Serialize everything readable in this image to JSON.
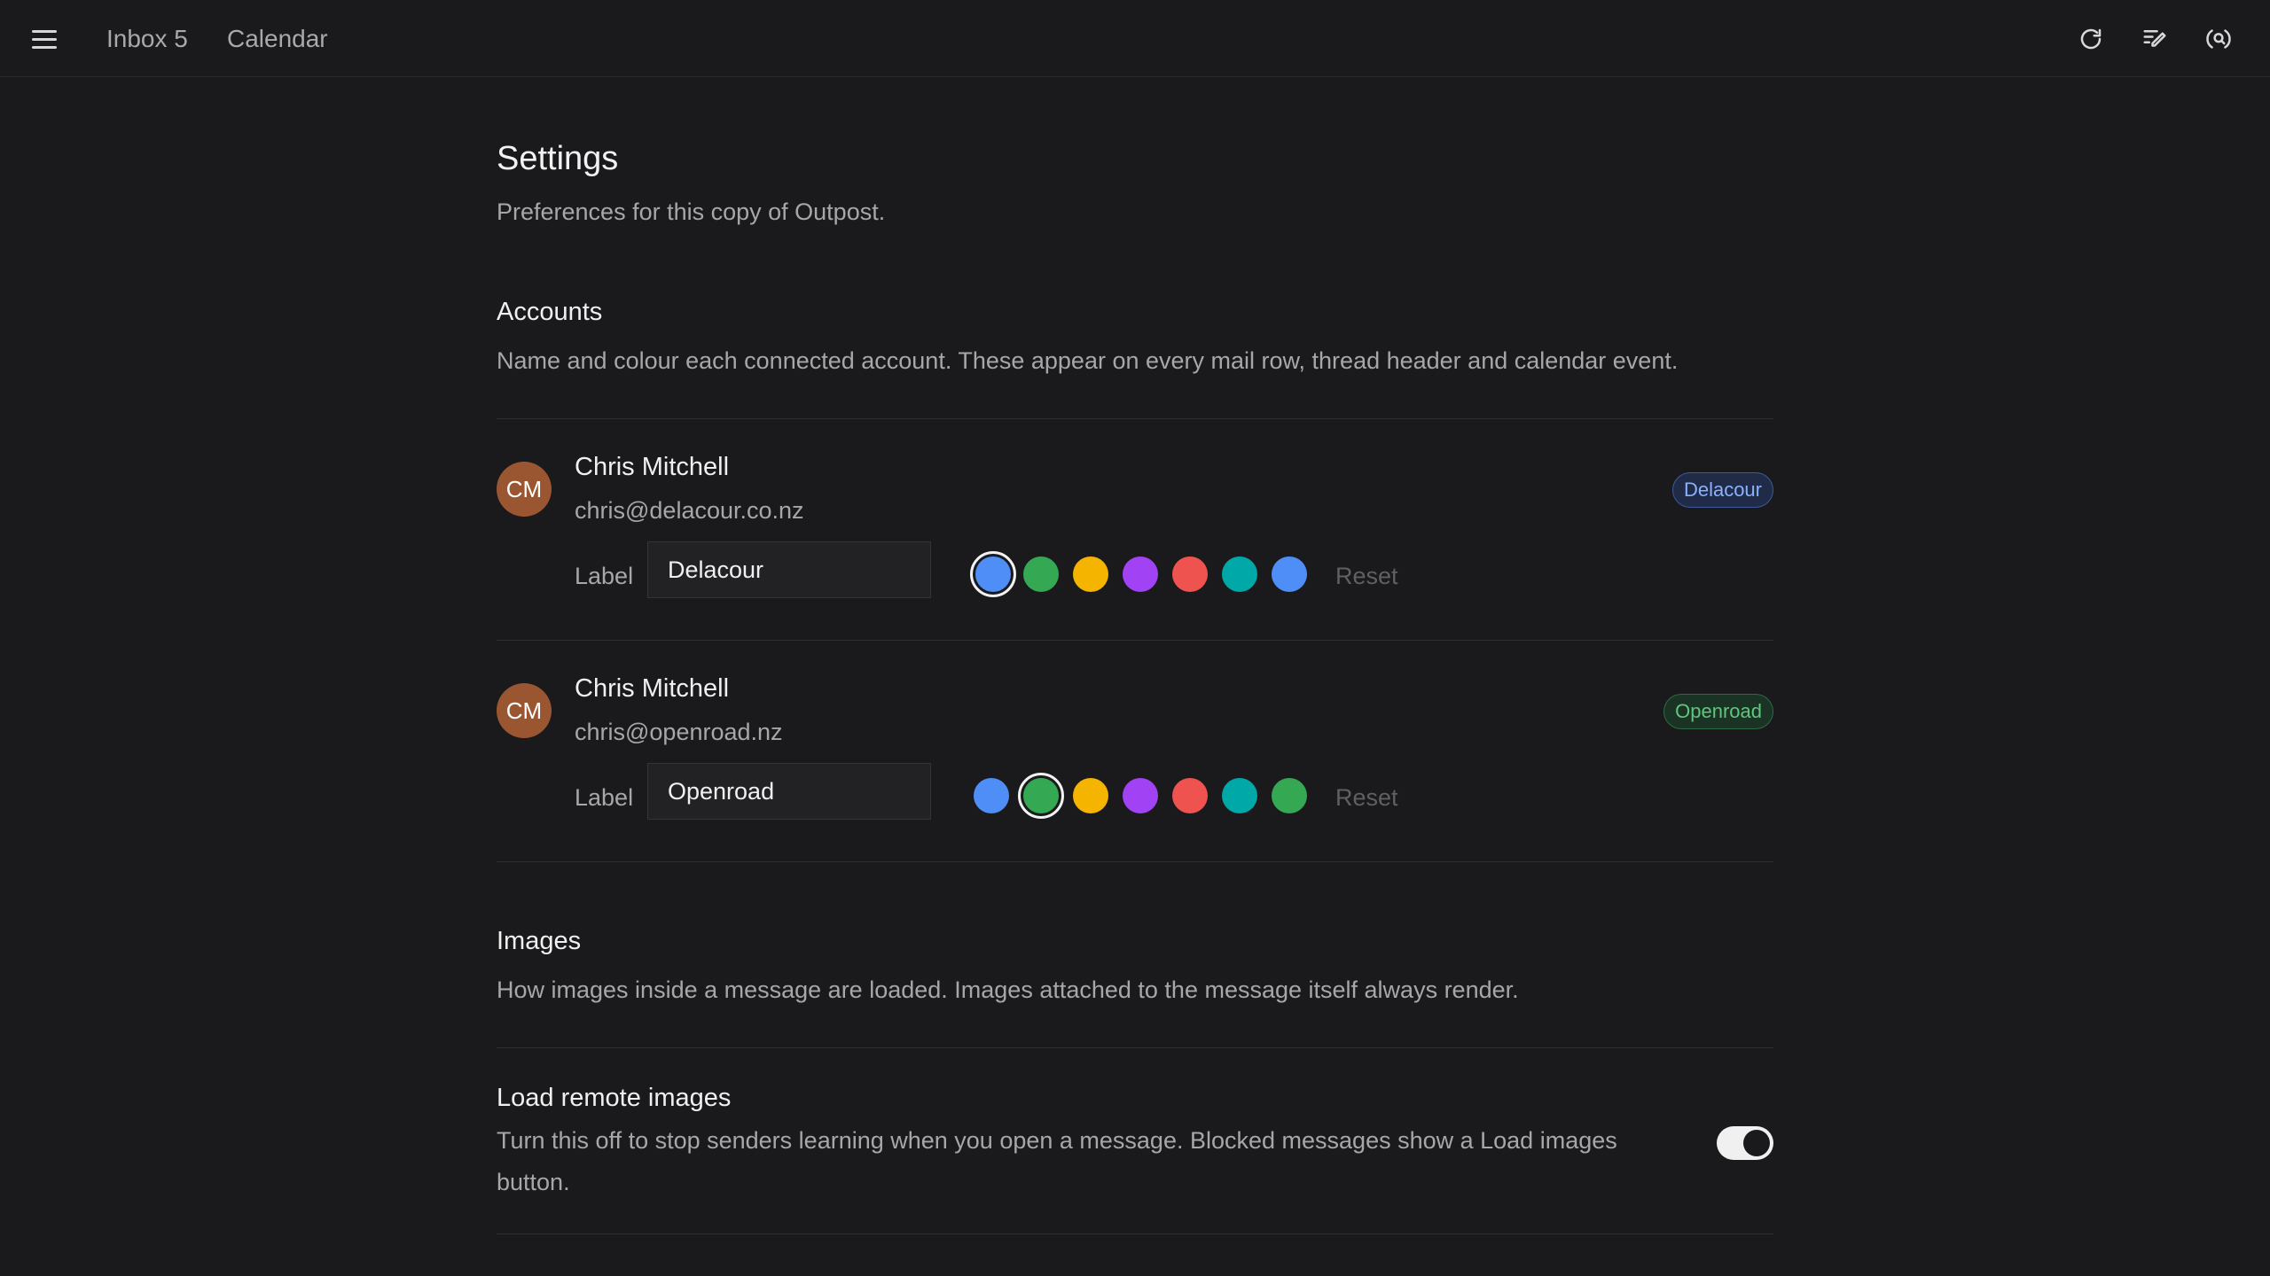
{
  "nav": {
    "inbox_label": "Inbox 5",
    "calendar_label": "Calendar"
  },
  "icons": {
    "menu": "hamburger-menu-icon",
    "refresh": "refresh-icon",
    "compose": "compose-icon",
    "account": "account-search-icon"
  },
  "page": {
    "title": "Settings",
    "subtitle": "Preferences for this copy of Outpost."
  },
  "accounts_section": {
    "title": "Accounts",
    "description": "Name and colour each connected account. These appear on every mail row, thread header and calendar event.",
    "label_text": "Label",
    "reset_label": "Reset",
    "accounts": [
      {
        "initials": "CM",
        "name": "Chris Mitchell",
        "email": "chris@delacour.co.nz",
        "label_value": "Delacour",
        "badge": "Delacour",
        "selected_color": "#4f8ef7",
        "swatches": [
          "#4f8ef7",
          "#34a853",
          "#f4b400",
          "#a142f4",
          "#ef5350",
          "#00a8a8",
          "#4f8ef7"
        ]
      },
      {
        "initials": "CM",
        "name": "Chris Mitchell",
        "email": "chris@openroad.nz",
        "label_value": "Openroad",
        "badge": "Openroad",
        "selected_color": "#34a853",
        "swatches": [
          "#4f8ef7",
          "#34a853",
          "#f4b400",
          "#a142f4",
          "#ef5350",
          "#00a8a8",
          "#34a853"
        ]
      }
    ]
  },
  "images_section": {
    "title": "Images",
    "description": "How images inside a message are loaded. Images attached to the message itself always render.",
    "remote": {
      "title": "Load remote images",
      "description": "Turn this off to stop senders learning when you open a message. Blocked messages show a Load images button.",
      "enabled": true
    }
  }
}
